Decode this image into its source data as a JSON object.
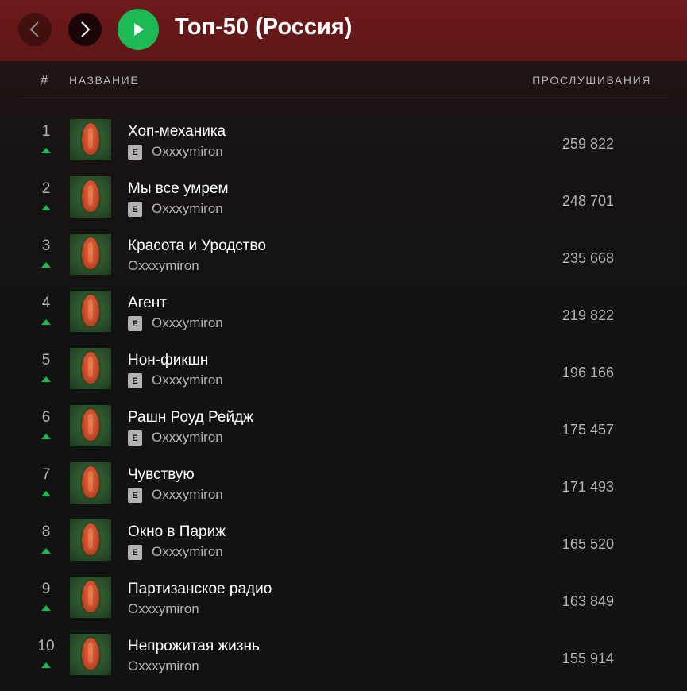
{
  "header": {
    "title": "Топ-50 (Россия)",
    "back_icon": "chevron-left-icon",
    "forward_icon": "chevron-right-icon",
    "play_icon": "play-icon"
  },
  "columns": {
    "number": "#",
    "title": "НАЗВАНИЕ",
    "plays": "ПРОСЛУШИВАНИЯ"
  },
  "colors": {
    "accent": "#1db954",
    "topbar": "#6e1a1a",
    "background": "#121212"
  },
  "explicit_label": "E",
  "tracks": [
    {
      "rank": "1",
      "title": "Хоп-механика",
      "artist": "Oxxxymiron",
      "explicit": true,
      "plays": "259 822",
      "trend": "up"
    },
    {
      "rank": "2",
      "title": "Мы все умрем",
      "artist": "Oxxxymiron",
      "explicit": true,
      "plays": "248 701",
      "trend": "up"
    },
    {
      "rank": "3",
      "title": "Красота и Уродство",
      "artist": "Oxxxymiron",
      "explicit": false,
      "plays": "235 668",
      "trend": "up"
    },
    {
      "rank": "4",
      "title": "Агент",
      "artist": "Oxxxymiron",
      "explicit": true,
      "plays": "219 822",
      "trend": "up"
    },
    {
      "rank": "5",
      "title": "Нон-фикшн",
      "artist": "Oxxxymiron",
      "explicit": true,
      "plays": "196 166",
      "trend": "up"
    },
    {
      "rank": "6",
      "title": "Рашн Роуд Рейдж",
      "artist": "Oxxxymiron",
      "explicit": true,
      "plays": "175 457",
      "trend": "up"
    },
    {
      "rank": "7",
      "title": "Чувствую",
      "artist": "Oxxxymiron",
      "explicit": true,
      "plays": "171 493",
      "trend": "up"
    },
    {
      "rank": "8",
      "title": "Окно в Париж",
      "artist": "Oxxxymiron",
      "explicit": true,
      "plays": "165 520",
      "trend": "up"
    },
    {
      "rank": "9",
      "title": "Партизанское радио",
      "artist": "Oxxxymiron",
      "explicit": false,
      "plays": "163 849",
      "trend": "up"
    },
    {
      "rank": "10",
      "title": "Непрожитая жизнь",
      "artist": "Oxxxymiron",
      "explicit": false,
      "plays": "155 914",
      "trend": "up"
    }
  ]
}
